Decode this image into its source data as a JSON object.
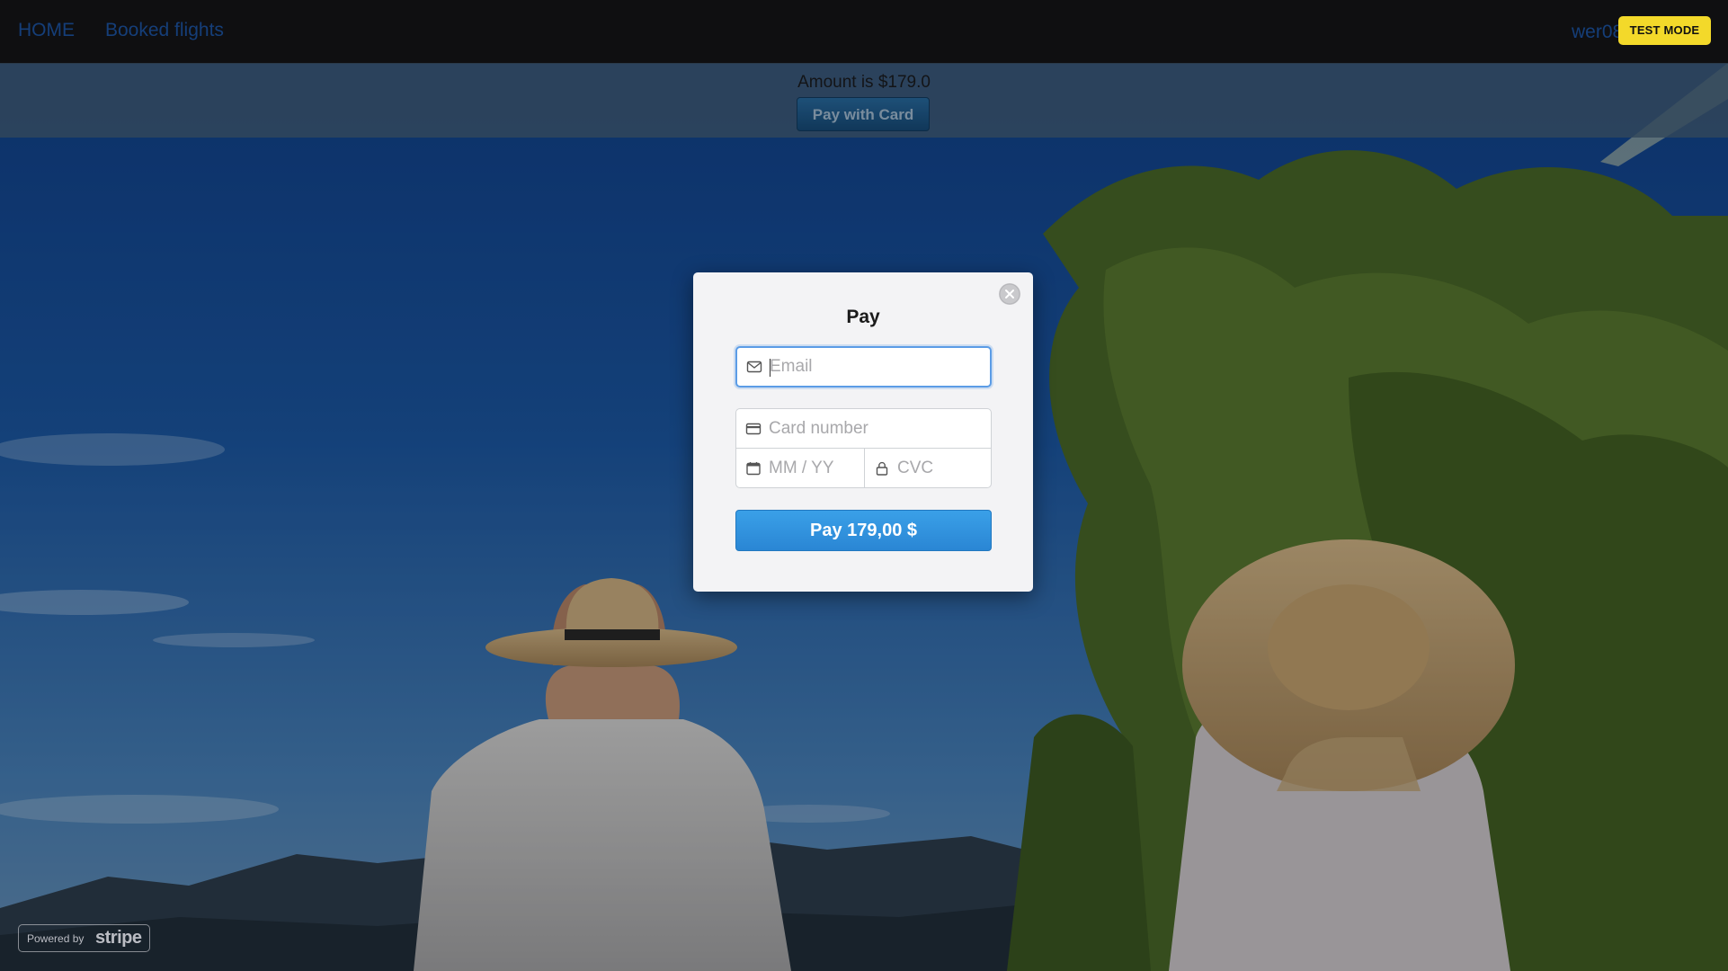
{
  "navbar": {
    "home_label": "HOME",
    "booked_label": "Booked flights",
    "user_label": "wer08",
    "test_mode_label": "TEST MODE"
  },
  "amount_band": {
    "amount_text": "Amount is $179.0",
    "pay_with_card_label": "Pay with Card"
  },
  "modal": {
    "title": "Pay",
    "email_placeholder": "Email",
    "card_number_placeholder": "Card number",
    "expiry_placeholder": "MM / YY",
    "cvc_placeholder": "CVC",
    "pay_button_label": "Pay 179,00 $",
    "close_icon": "close-icon",
    "email_icon": "envelope-icon",
    "card_icon": "credit-card-icon",
    "expiry_icon": "calendar-icon",
    "cvc_icon": "lock-icon"
  },
  "stripe_badge": {
    "powered_label": "Powered by",
    "brand_label": "stripe"
  },
  "colors": {
    "nav_bg": "#151618",
    "nav_link": "#1e57a8",
    "test_mode_bg": "#f3d92a",
    "pay_button": "#2f90dc",
    "focus_border": "#5b9ce6"
  }
}
